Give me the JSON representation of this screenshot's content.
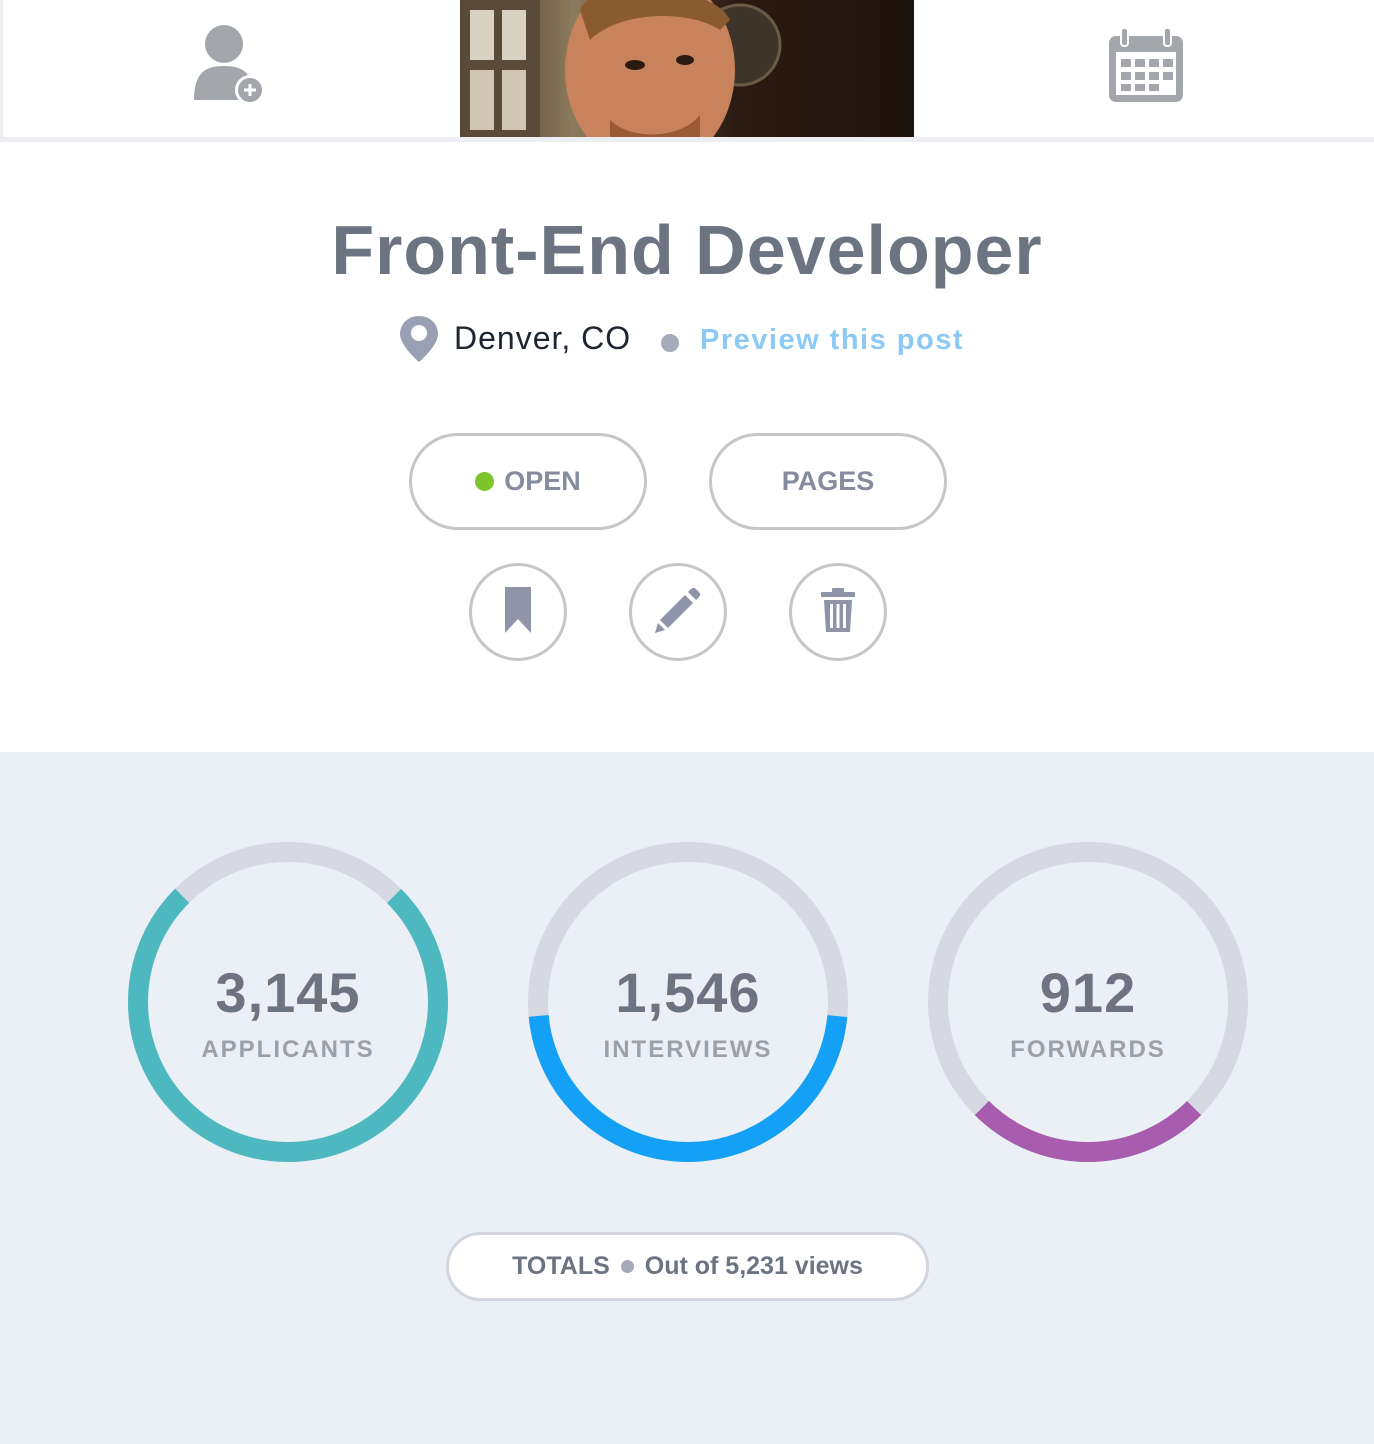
{
  "header": {
    "profile_photo_alt": "Profile photo"
  },
  "job": {
    "title": "Front-End Developer",
    "location": "Denver, CO",
    "preview_link": "Preview this post"
  },
  "actions": {
    "status_label": "OPEN",
    "pages_label": "PAGES",
    "status_color": "#7ec52b"
  },
  "icons": {
    "add_user": "add-user-icon",
    "calendar": "calendar-icon",
    "location": "location-pin-icon",
    "bookmark": "bookmark-icon",
    "edit": "pencil-icon",
    "delete": "trash-icon"
  },
  "stats": [
    {
      "value": "3,145",
      "label": "APPLICANTS",
      "color": "#4db8bf",
      "fraction": 0.75
    },
    {
      "value": "1,546",
      "label": "INTERVIEWS",
      "color": "#14a0f5",
      "fraction": 0.47
    },
    {
      "value": "912",
      "label": "FORWARDS",
      "color": "#a85cae",
      "fraction": 0.25
    }
  ],
  "totals": {
    "label": "TOTALS",
    "text": "Out of 5,231 views"
  },
  "colors": {
    "ring_track": "#d6d9e2",
    "stats_background": "#ebeff6"
  }
}
